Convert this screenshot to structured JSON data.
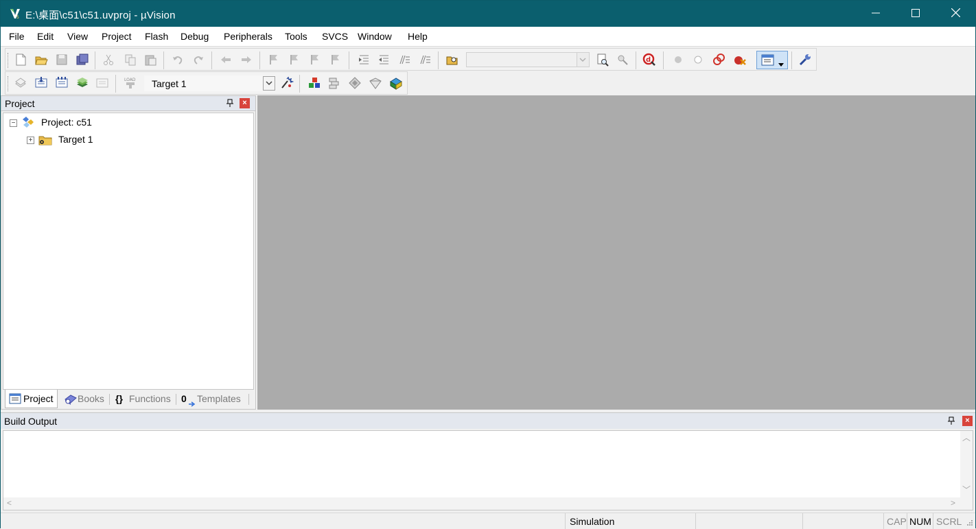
{
  "window": {
    "title": "E:\\桌面\\c51\\c51.uvproj - µVision",
    "controls": {
      "minimize": "minimize",
      "maximize": "maximize",
      "close": "close"
    }
  },
  "menu": {
    "items": [
      "File",
      "Edit",
      "View",
      "Project",
      "Flash",
      "Debug",
      "Peripherals",
      "Tools",
      "SVCS",
      "Window",
      "Help"
    ]
  },
  "toolbar1": {
    "icons": [
      "new-file-icon",
      "open-folder-icon",
      "save-icon",
      "save-all-icon",
      "cut-icon",
      "copy-icon",
      "paste-icon",
      "undo-icon",
      "redo-icon",
      "navigate-back-icon",
      "navigate-forward-icon",
      "bookmark-icon",
      "prev-bookmark-icon",
      "next-bookmark-icon",
      "clear-bookmarks-icon",
      "indent-icon",
      "unindent-icon",
      "comment-icon",
      "uncomment-icon",
      "find-in-files-icon",
      "find-icon",
      "incremental-find-icon",
      "debug-session-icon",
      "breakpoint-icon",
      "disable-breakpoint-icon",
      "disable-all-breakpoints-icon",
      "kill-all-breakpoints-icon",
      "window-layout-icon",
      "configure-icon"
    ],
    "find_combo_value": ""
  },
  "toolbar2": {
    "icons": [
      "translate-icon",
      "build-icon",
      "rebuild-icon",
      "batch-build-icon",
      "stop-build-icon",
      "download-icon",
      "target-options-icon",
      "manage-components-icon",
      "select-packs-icon",
      "pack-installer-icon",
      "manage-run-time-icon",
      "project-environment-icon"
    ],
    "target_value": "Target 1"
  },
  "project_panel": {
    "title": "Project",
    "tree": {
      "root_label": "Project: c51",
      "root_expander": "−",
      "children": [
        {
          "label": "Target 1",
          "expander": "+"
        }
      ]
    },
    "tabs": [
      {
        "label": "Project",
        "icon": "project-tab-icon"
      },
      {
        "label": "Books",
        "icon": "books-icon"
      },
      {
        "label": "Functions",
        "icon": "functions-icon",
        "glyph": "{}"
      },
      {
        "label": "Templates",
        "icon": "templates-icon",
        "glyph": "0"
      }
    ]
  },
  "build_output": {
    "title": "Build Output",
    "content": ""
  },
  "statusbar": {
    "mode": "Simulation",
    "cap": "CAP",
    "num": "NUM",
    "scrl": "SCRL"
  },
  "colors": {
    "titlebar": "#0b5f6e",
    "editor_background": "#ababab",
    "panel_header": "#e3e7ee",
    "close_button_red": "#d8443c"
  }
}
